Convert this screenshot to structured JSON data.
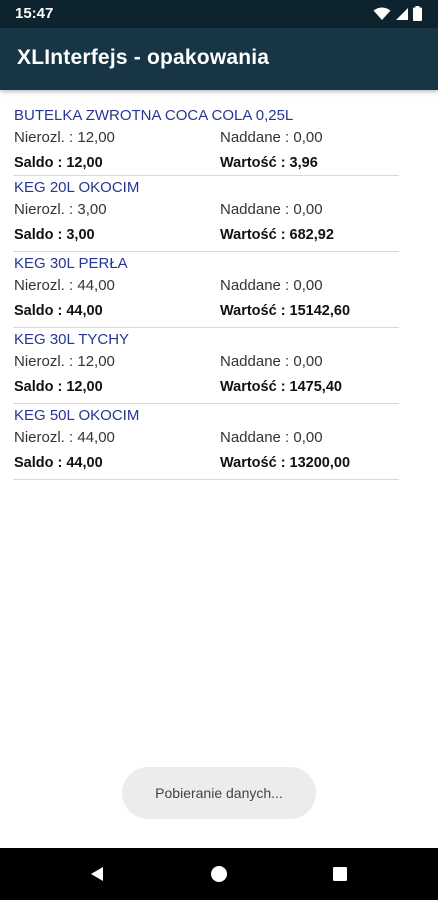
{
  "status_bar": {
    "time": "15:47",
    "icons": [
      "wifi-icon",
      "signal-icon",
      "battery-icon"
    ]
  },
  "app_bar": {
    "title": "XLInterfejs - opakowania"
  },
  "items": [
    {
      "name": "BUTELKA ZWROTNA COCA COLA 0,25L",
      "nierozl": "Nierozl. : 12,00",
      "naddane": "Naddane : 0,00",
      "saldo": "Saldo : 12,00",
      "wartosc": "Wartość : 3,96"
    },
    {
      "name": "KEG 20L OKOCIM",
      "nierozl": "Nierozl. : 3,00",
      "naddane": "Naddane : 0,00",
      "saldo": "Saldo : 3,00",
      "wartosc": "Wartość : 682,92"
    },
    {
      "name": "KEG 30L PERŁA",
      "nierozl": "Nierozl. : 44,00",
      "naddane": "Naddane : 0,00",
      "saldo": "Saldo : 44,00",
      "wartosc": "Wartość : 15142,60"
    },
    {
      "name": "KEG 30L TYCHY",
      "nierozl": "Nierozl. : 12,00",
      "naddane": "Naddane : 0,00",
      "saldo": "Saldo : 12,00",
      "wartosc": "Wartość : 1475,40"
    },
    {
      "name": "KEG 50L OKOCIM",
      "nierozl": "Nierozl. : 44,00",
      "naddane": "Naddane : 0,00",
      "saldo": "Saldo : 44,00",
      "wartosc": "Wartość : 13200,00"
    }
  ],
  "toast": {
    "text": "Pobieranie danych..."
  },
  "nav_bar": {
    "buttons": [
      "back-icon",
      "home-icon",
      "recents-icon"
    ]
  },
  "colors": {
    "status_bar": "#0d232d",
    "app_bar": "#173544",
    "item_name": "#283593"
  }
}
